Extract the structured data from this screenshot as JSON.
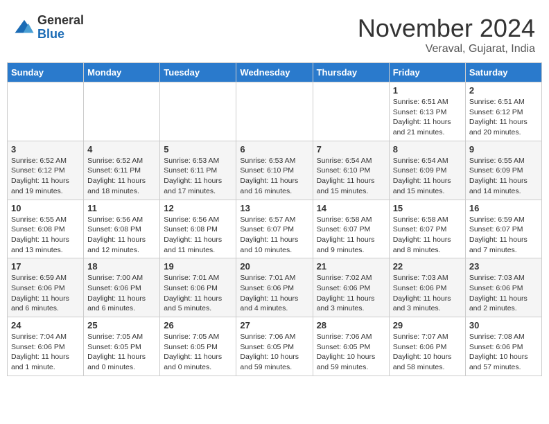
{
  "logo": {
    "general": "General",
    "blue": "Blue"
  },
  "title": {
    "month": "November 2024",
    "location": "Veraval, Gujarat, India"
  },
  "weekdays": [
    "Sunday",
    "Monday",
    "Tuesday",
    "Wednesday",
    "Thursday",
    "Friday",
    "Saturday"
  ],
  "weeks": [
    [
      {
        "day": "",
        "info": ""
      },
      {
        "day": "",
        "info": ""
      },
      {
        "day": "",
        "info": ""
      },
      {
        "day": "",
        "info": ""
      },
      {
        "day": "",
        "info": ""
      },
      {
        "day": "1",
        "info": "Sunrise: 6:51 AM\nSunset: 6:13 PM\nDaylight: 11 hours\nand 21 minutes."
      },
      {
        "day": "2",
        "info": "Sunrise: 6:51 AM\nSunset: 6:12 PM\nDaylight: 11 hours\nand 20 minutes."
      }
    ],
    [
      {
        "day": "3",
        "info": "Sunrise: 6:52 AM\nSunset: 6:12 PM\nDaylight: 11 hours\nand 19 minutes."
      },
      {
        "day": "4",
        "info": "Sunrise: 6:52 AM\nSunset: 6:11 PM\nDaylight: 11 hours\nand 18 minutes."
      },
      {
        "day": "5",
        "info": "Sunrise: 6:53 AM\nSunset: 6:11 PM\nDaylight: 11 hours\nand 17 minutes."
      },
      {
        "day": "6",
        "info": "Sunrise: 6:53 AM\nSunset: 6:10 PM\nDaylight: 11 hours\nand 16 minutes."
      },
      {
        "day": "7",
        "info": "Sunrise: 6:54 AM\nSunset: 6:10 PM\nDaylight: 11 hours\nand 15 minutes."
      },
      {
        "day": "8",
        "info": "Sunrise: 6:54 AM\nSunset: 6:09 PM\nDaylight: 11 hours\nand 15 minutes."
      },
      {
        "day": "9",
        "info": "Sunrise: 6:55 AM\nSunset: 6:09 PM\nDaylight: 11 hours\nand 14 minutes."
      }
    ],
    [
      {
        "day": "10",
        "info": "Sunrise: 6:55 AM\nSunset: 6:08 PM\nDaylight: 11 hours\nand 13 minutes."
      },
      {
        "day": "11",
        "info": "Sunrise: 6:56 AM\nSunset: 6:08 PM\nDaylight: 11 hours\nand 12 minutes."
      },
      {
        "day": "12",
        "info": "Sunrise: 6:56 AM\nSunset: 6:08 PM\nDaylight: 11 hours\nand 11 minutes."
      },
      {
        "day": "13",
        "info": "Sunrise: 6:57 AM\nSunset: 6:07 PM\nDaylight: 11 hours\nand 10 minutes."
      },
      {
        "day": "14",
        "info": "Sunrise: 6:58 AM\nSunset: 6:07 PM\nDaylight: 11 hours\nand 9 minutes."
      },
      {
        "day": "15",
        "info": "Sunrise: 6:58 AM\nSunset: 6:07 PM\nDaylight: 11 hours\nand 8 minutes."
      },
      {
        "day": "16",
        "info": "Sunrise: 6:59 AM\nSunset: 6:07 PM\nDaylight: 11 hours\nand 7 minutes."
      }
    ],
    [
      {
        "day": "17",
        "info": "Sunrise: 6:59 AM\nSunset: 6:06 PM\nDaylight: 11 hours\nand 6 minutes."
      },
      {
        "day": "18",
        "info": "Sunrise: 7:00 AM\nSunset: 6:06 PM\nDaylight: 11 hours\nand 6 minutes."
      },
      {
        "day": "19",
        "info": "Sunrise: 7:01 AM\nSunset: 6:06 PM\nDaylight: 11 hours\nand 5 minutes."
      },
      {
        "day": "20",
        "info": "Sunrise: 7:01 AM\nSunset: 6:06 PM\nDaylight: 11 hours\nand 4 minutes."
      },
      {
        "day": "21",
        "info": "Sunrise: 7:02 AM\nSunset: 6:06 PM\nDaylight: 11 hours\nand 3 minutes."
      },
      {
        "day": "22",
        "info": "Sunrise: 7:03 AM\nSunset: 6:06 PM\nDaylight: 11 hours\nand 3 minutes."
      },
      {
        "day": "23",
        "info": "Sunrise: 7:03 AM\nSunset: 6:06 PM\nDaylight: 11 hours\nand 2 minutes."
      }
    ],
    [
      {
        "day": "24",
        "info": "Sunrise: 7:04 AM\nSunset: 6:06 PM\nDaylight: 11 hours\nand 1 minute."
      },
      {
        "day": "25",
        "info": "Sunrise: 7:05 AM\nSunset: 6:05 PM\nDaylight: 11 hours\nand 0 minutes."
      },
      {
        "day": "26",
        "info": "Sunrise: 7:05 AM\nSunset: 6:05 PM\nDaylight: 11 hours\nand 0 minutes."
      },
      {
        "day": "27",
        "info": "Sunrise: 7:06 AM\nSunset: 6:05 PM\nDaylight: 10 hours\nand 59 minutes."
      },
      {
        "day": "28",
        "info": "Sunrise: 7:06 AM\nSunset: 6:05 PM\nDaylight: 10 hours\nand 59 minutes."
      },
      {
        "day": "29",
        "info": "Sunrise: 7:07 AM\nSunset: 6:06 PM\nDaylight: 10 hours\nand 58 minutes."
      },
      {
        "day": "30",
        "info": "Sunrise: 7:08 AM\nSunset: 6:06 PM\nDaylight: 10 hours\nand 57 minutes."
      }
    ]
  ]
}
